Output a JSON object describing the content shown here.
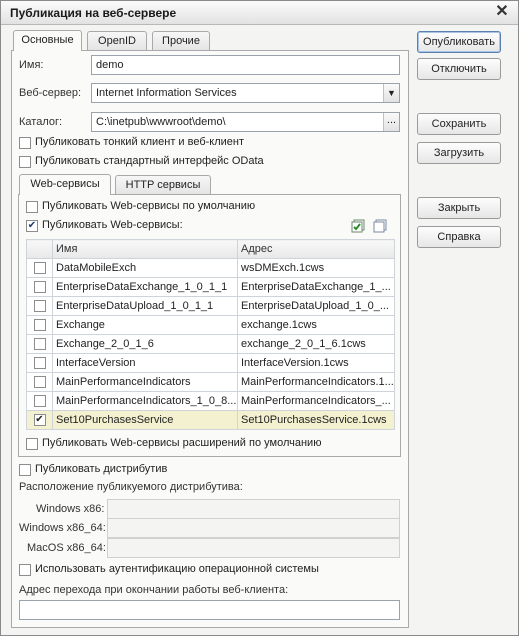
{
  "window": {
    "title": "Публикация на веб-сервере"
  },
  "tabs": [
    "Основные",
    "OpenID",
    "Прочие"
  ],
  "fields": {
    "name_label": "Имя:",
    "name_value": "demo",
    "webserver_label": "Веб-сервер:",
    "webserver_value": "Internet Information Services",
    "catalog_label": "Каталог:",
    "catalog_value": "C:\\inetpub\\wwwroot\\demo\\",
    "catalog_browse": "..."
  },
  "checkboxes": {
    "thin_client": "Публиковать тонкий клиент и веб-клиент",
    "odata": "Публиковать стандартный интерфейс OData"
  },
  "subtabs": [
    "Web-сервисы",
    "HTTP сервисы"
  ],
  "ws": {
    "default_label": "Публиковать Web-сервисы по умолчанию",
    "publish_label": "Публиковать Web-сервисы:",
    "col_name": "Имя",
    "col_address": "Адрес",
    "rows": [
      {
        "name": "DataMobileExch",
        "address": "wsDMExch.1cws",
        "checked": false
      },
      {
        "name": "EnterpriseDataExchange_1_0_1_1",
        "address": "EnterpriseDataExchange_1_...",
        "checked": false
      },
      {
        "name": "EnterpriseDataUpload_1_0_1_1",
        "address": "EnterpriseDataUpload_1_0_...",
        "checked": false
      },
      {
        "name": "Exchange",
        "address": "exchange.1cws",
        "checked": false
      },
      {
        "name": "Exchange_2_0_1_6",
        "address": "exchange_2_0_1_6.1cws",
        "checked": false
      },
      {
        "name": "InterfaceVersion",
        "address": "InterfaceVersion.1cws",
        "checked": false
      },
      {
        "name": "MainPerformanceIndicators",
        "address": "MainPerformanceIndicators.1...",
        "checked": false
      },
      {
        "name": "MainPerformanceIndicators_1_0_8...",
        "address": "MainPerformanceIndicators_...",
        "checked": false
      },
      {
        "name": "Set10PurchasesService",
        "address": "Set10PurchasesService.1cws",
        "checked": true
      }
    ],
    "extensions_label": "Публиковать Web-сервисы расширений по умолчанию"
  },
  "distrib": {
    "publish_label": "Публиковать дистрибутив",
    "location_label": "Расположение публикуемого дистрибутива:",
    "win86_label": "Windows x86:",
    "win64_label": "Windows x86_64:",
    "macos_label": "MacOS x86_64:"
  },
  "os_auth_label": "Использовать аутентификацию операционной системы",
  "redirect_label": "Адрес перехода при окончании работы веб-клиента:",
  "buttons": {
    "publish": "Опубликовать",
    "disable": "Отключить",
    "save": "Сохранить",
    "load": "Загрузить",
    "close": "Закрыть",
    "help": "Справка"
  },
  "checkmark": "✔"
}
